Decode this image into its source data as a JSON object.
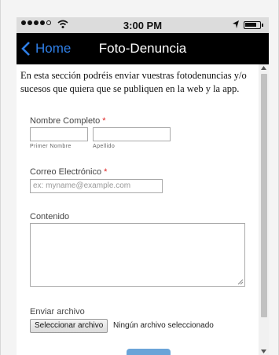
{
  "status_bar": {
    "time": "3:00 PM"
  },
  "nav": {
    "back_label": "Home",
    "title": "Foto-Denuncia"
  },
  "intro_text": "En esta sección podréis enviar vuestras fotodenuncias y/o sucesos que quiera que se publiquen en la web y la app.",
  "form": {
    "name": {
      "label": "Nombre Completo",
      "required_mark": "*",
      "first_sublabel": "Primer Nombre",
      "last_sublabel": "Apellido"
    },
    "email": {
      "label": "Correo Electrónico",
      "required_mark": "*",
      "placeholder": "ex: myname@example.com"
    },
    "content": {
      "label": "Contenido"
    },
    "file": {
      "label": "Enviar archivo",
      "button_label": "Seleccionar archivo",
      "status": "Ningún archivo seleccionado"
    }
  },
  "colors": {
    "nav_bg": "#000000",
    "back_link": "#2f7fe7",
    "required": "#dd2222"
  }
}
